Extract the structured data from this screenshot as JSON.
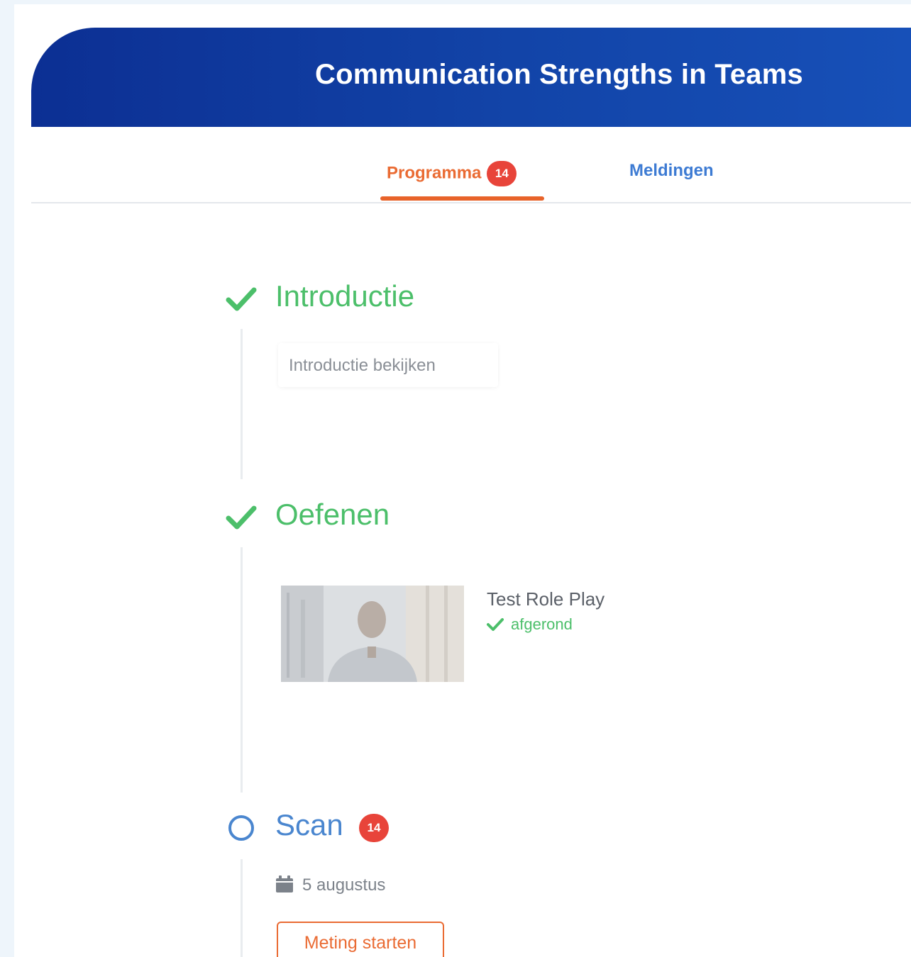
{
  "header": {
    "title": "Communication Strengths in Teams"
  },
  "tabs": [
    {
      "label": "Programma",
      "badge": "14",
      "active": true
    },
    {
      "label": "Meldingen",
      "active": false
    }
  ],
  "sections": [
    {
      "title": "Introductie",
      "state": "done",
      "icon": "check-icon",
      "items": [
        {
          "label": "Introductie bekijken"
        }
      ]
    },
    {
      "title": "Oefenen",
      "state": "done",
      "icon": "check-icon",
      "items": [
        {
          "title": "Test Role Play",
          "status": "afgerond",
          "thumbnail": "video-thumbnail"
        }
      ]
    },
    {
      "title": "Scan",
      "state": "open",
      "icon": "circle-outline-icon",
      "badge": "14",
      "date": "5 augustus",
      "action": "Meting starten"
    }
  ],
  "colors": {
    "brand": "#0c2f93",
    "accent": "#e8632a",
    "done": "#4cbf6a",
    "open": "#4a86cf",
    "badge": "#e8443a"
  }
}
